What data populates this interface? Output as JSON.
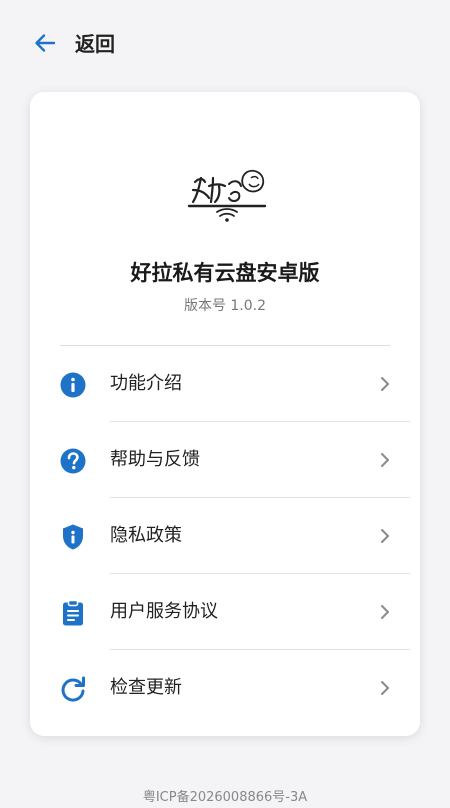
{
  "header": {
    "back_icon": "arrow-left-icon",
    "title": "返回"
  },
  "app": {
    "logo_icon": "app-logo",
    "name": "好拉私有云盘安卓版",
    "version": "版本号 1.0.2"
  },
  "menu": {
    "items": [
      {
        "label": "功能介绍",
        "icon": "info-icon"
      },
      {
        "label": "帮助与反馈",
        "icon": "help-icon"
      },
      {
        "label": "隐私政策",
        "icon": "shield-icon"
      },
      {
        "label": "用户服务协议",
        "icon": "clipboard-icon"
      },
      {
        "label": "检查更新",
        "icon": "refresh-icon"
      }
    ],
    "chevron_icon": "chevron-right-icon"
  },
  "footer": {
    "icp": "粤ICP备2026008866号-3A"
  },
  "colors": {
    "accent": "#1e73c8",
    "background": "#f4f4f6",
    "card": "#ffffff",
    "chevron": "#8a8a8a"
  }
}
